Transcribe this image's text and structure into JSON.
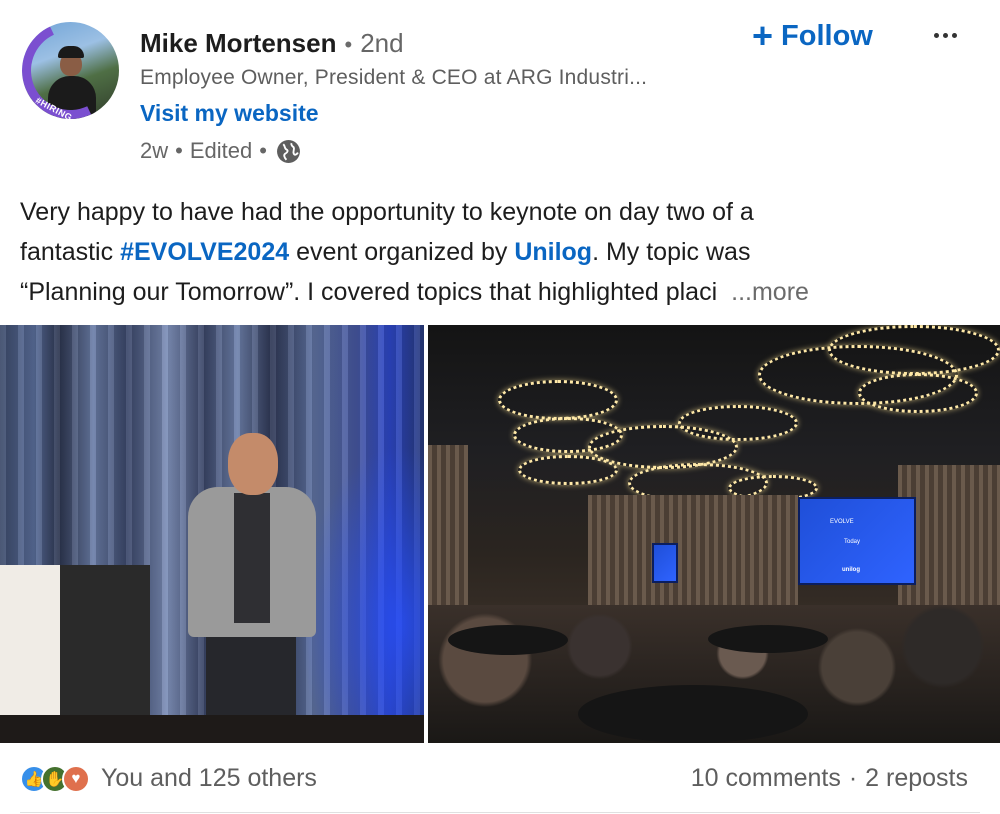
{
  "author": {
    "name": "Mike Mortensen",
    "degree": "2nd",
    "headline": "Employee Owner, President & CEO at ARG Industri...",
    "website_label": "Visit my website",
    "time": "2w",
    "edited_label": "Edited",
    "visibility_icon": "globe-icon",
    "avatar_badge": "#HIRING"
  },
  "actions": {
    "follow_label": "Follow",
    "follow_icon": "plus-icon",
    "more_icon": "ellipsis-icon"
  },
  "post": {
    "line1": "Very happy to have had the opportunity to keynote on day two of a",
    "line2_pre": "fantastic ",
    "hashtag": "#EVOLVE2024",
    "line2_mid": " event organized by ",
    "mention": "Unilog",
    "line2_post": ". My topic was",
    "line3": "“Planning our Tomorrow”. I covered topics that highlighted placi",
    "see_more": "...more"
  },
  "screen": {
    "brand": "unilog",
    "line_a": "EVOLVE",
    "line_b": "Today"
  },
  "engagement": {
    "reaction_icons": [
      "like-icon",
      "celebrate-icon",
      "love-icon"
    ],
    "reactions_text": "You and 125 others",
    "comments": "10 comments",
    "reposts": "2 reposts"
  },
  "colors": {
    "link_blue": "#0a66c2",
    "text_primary": "#1d1d1d",
    "text_secondary": "#666666"
  }
}
